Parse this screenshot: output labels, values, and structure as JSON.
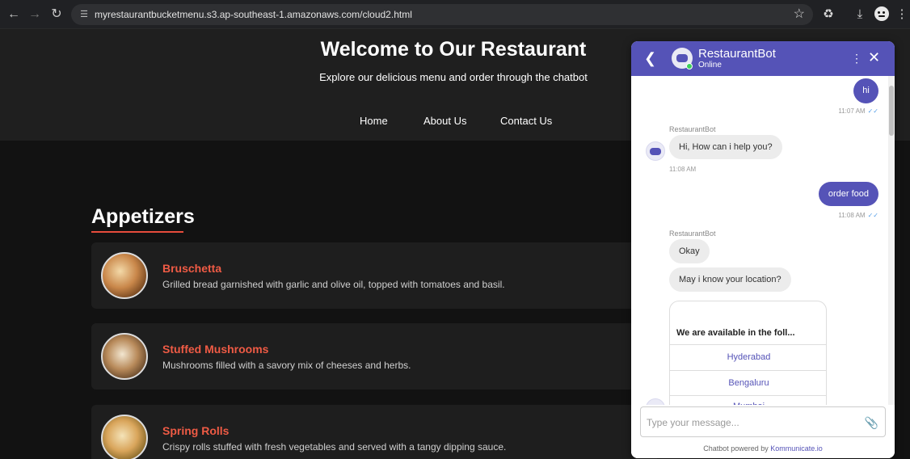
{
  "browser": {
    "url": "myrestaurantbucketmenu.s3.ap-southeast-1.amazonaws.com/cloud2.html"
  },
  "hero": {
    "title": "Welcome to Our Restaurant",
    "subtitle": "Explore our delicious menu and order through the chatbot",
    "nav": [
      "Home",
      "About Us",
      "Contact Us"
    ]
  },
  "menu": {
    "section_title": "Appetizers",
    "items": [
      {
        "name": "Bruschetta",
        "description": "Grilled bread garnished with garlic and olive oil, topped with tomatoes and basil."
      },
      {
        "name": "Stuffed Mushrooms",
        "description": "Mushrooms filled with a savory mix of cheeses and herbs."
      },
      {
        "name": "Spring Rolls",
        "description": "Crispy rolls stuffed with fresh vegetables and served with a tangy dipping sauce."
      }
    ]
  },
  "chat": {
    "bot_name": "RestaurantBot",
    "status": "Online",
    "messages": [
      {
        "from": "user",
        "text": "hi",
        "time": "11:07 AM"
      },
      {
        "from": "bot",
        "sender": "RestaurantBot",
        "text": "Hi, How can i help you?",
        "time": "11:08 AM"
      },
      {
        "from": "user",
        "text": "order food",
        "time": "11:08 AM"
      },
      {
        "from": "bot",
        "sender": "RestaurantBot",
        "text": "Okay"
      },
      {
        "from": "bot",
        "text": "May i know your location?"
      }
    ],
    "location_card": {
      "title": "We are available in the foll...",
      "options": [
        "Hyderabad",
        "Bengaluru",
        "Mumbai"
      ]
    },
    "input_placeholder": "Type your message...",
    "powered_by_prefix": "Chatbot powered by ",
    "powered_by_brand": "Kommunicate.io"
  },
  "colors": {
    "accent": "#5553b7",
    "dish_name": "#ef5b45",
    "page_bg": "#121212",
    "card_bg": "#1e1e1e"
  },
  "icons": [
    "back-arrow-icon",
    "forward-arrow-icon",
    "reload-icon",
    "site-info-icon",
    "bookmark-star-icon",
    "extensions-icon",
    "download-icon",
    "profile-avatar-icon",
    "browser-menu-icon",
    "chevron-left-icon",
    "bot-avatar-icon",
    "more-vertical-icon",
    "close-icon",
    "read-receipt-icon",
    "attachment-icon"
  ]
}
